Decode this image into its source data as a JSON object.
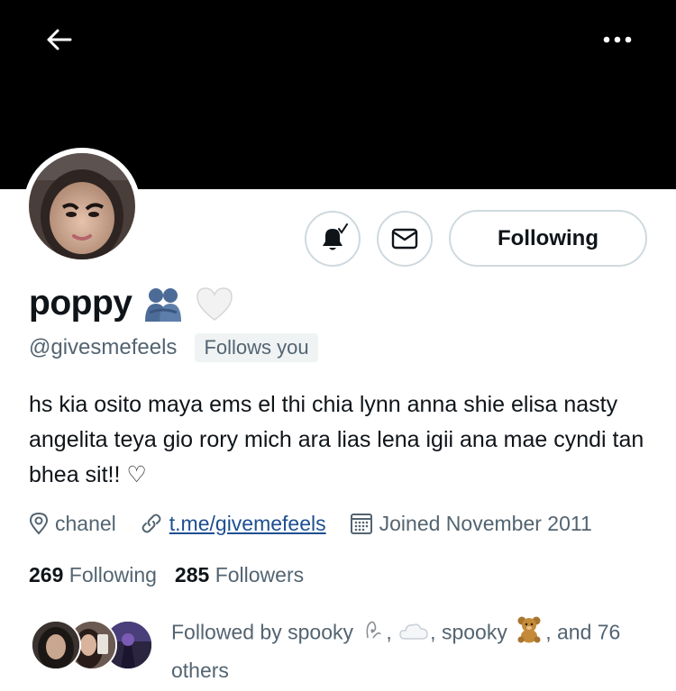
{
  "header": {
    "back_icon": "arrow-left-icon",
    "more_icon": "more-horizontal-icon",
    "banner_color": "#000000"
  },
  "actions": {
    "notifications_icon": "bell-check-icon",
    "message_icon": "envelope-icon",
    "following_label": "Following"
  },
  "profile": {
    "display_name": "poppy",
    "name_emojis": [
      "hugging-people-emoji",
      "white-heart-emoji"
    ],
    "handle": "@givesmefeels",
    "follows_you_label": "Follows you",
    "bio": "hs kia osito maya ems el thi chia lynn anna shie elisa nasty angelita teya gio rory mich ara lias lena igii ana mae cyndi tan bhea sit!! ♡",
    "location": "chanel",
    "website": "t.me/givemefeels",
    "joined": "Joined November 2011"
  },
  "stats": {
    "following_count": "269",
    "following_label": "Following",
    "followers_count": "285",
    "followers_label": "Followers"
  },
  "followed_by": {
    "prefix": "Followed by spooky",
    "separator_1": ",",
    "separator_2": ",",
    "name_2": "spooky",
    "suffix": ", and 76 others"
  },
  "colors": {
    "text_primary": "#0f1419",
    "text_secondary": "#536471",
    "border": "#cfd9de",
    "link": "#1d4f91"
  }
}
